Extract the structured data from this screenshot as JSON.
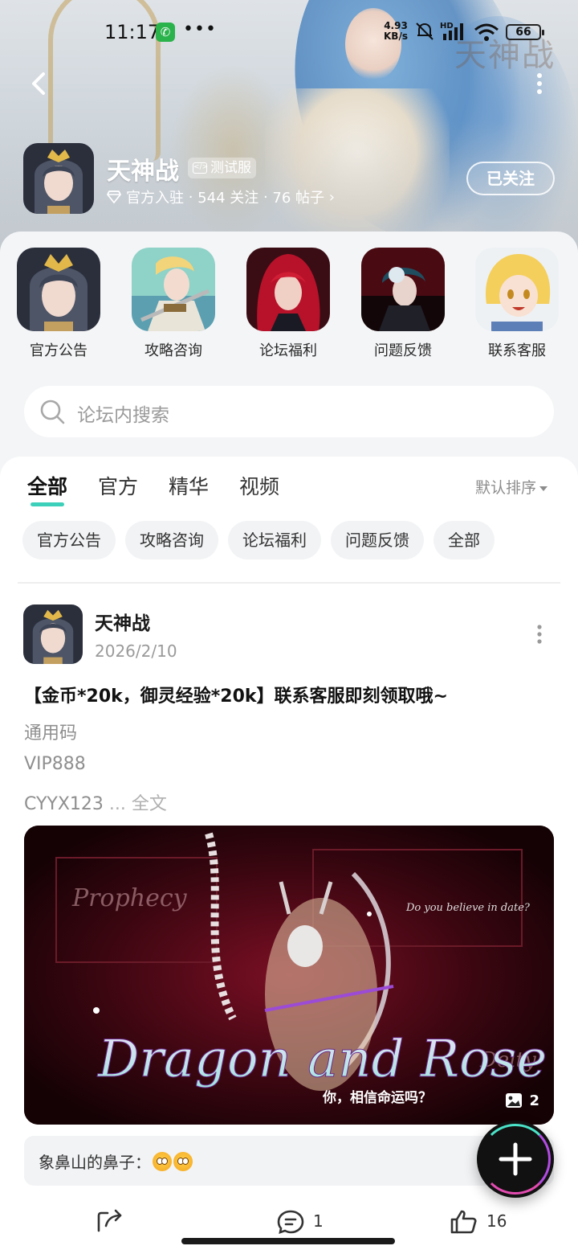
{
  "status_bar": {
    "time": "11:17",
    "speed_value": "4.93",
    "speed_unit": "KB/s",
    "network": "HD",
    "battery": "66"
  },
  "forum": {
    "name": "天神战",
    "badge": "测试服",
    "official": "官方入驻",
    "followers": "544 关注",
    "posts": "76 帖子",
    "follow_label": "已关注",
    "banner_logo": "天神战"
  },
  "shortcuts": [
    {
      "label": "官方公告"
    },
    {
      "label": "攻略咨询"
    },
    {
      "label": "论坛福利"
    },
    {
      "label": "问题反馈"
    },
    {
      "label": "联系客服"
    }
  ],
  "search": {
    "placeholder": "论坛内搜索"
  },
  "tabs": [
    "全部",
    "官方",
    "精华",
    "视频"
  ],
  "sort_label": "默认排序",
  "chips": [
    "官方公告",
    "攻略咨询",
    "论坛福利",
    "问题反馈",
    "全部"
  ],
  "post": {
    "author": "天神战",
    "date": "2026/2/10",
    "title": "【金币*20k，御灵经验*20k】联系客服即刻领取哦~",
    "lines": [
      "通用码",
      "VIP888",
      "CYYX123"
    ],
    "ellipsis": " ... ",
    "full_text": "全文",
    "image_title": "Dragon and Rose",
    "image_caption": "你，相信命运吗？",
    "image_side_text": "Prophecy",
    "image_side_text2": "Deity",
    "image_question": "Do you believe in date?",
    "image_count": "2",
    "comment": "象鼻山的鼻子：",
    "comment_count": "1",
    "like_count": "16"
  },
  "colors": {
    "accent": "#3ccfb9",
    "panel_bg": "#f4f5f7"
  }
}
